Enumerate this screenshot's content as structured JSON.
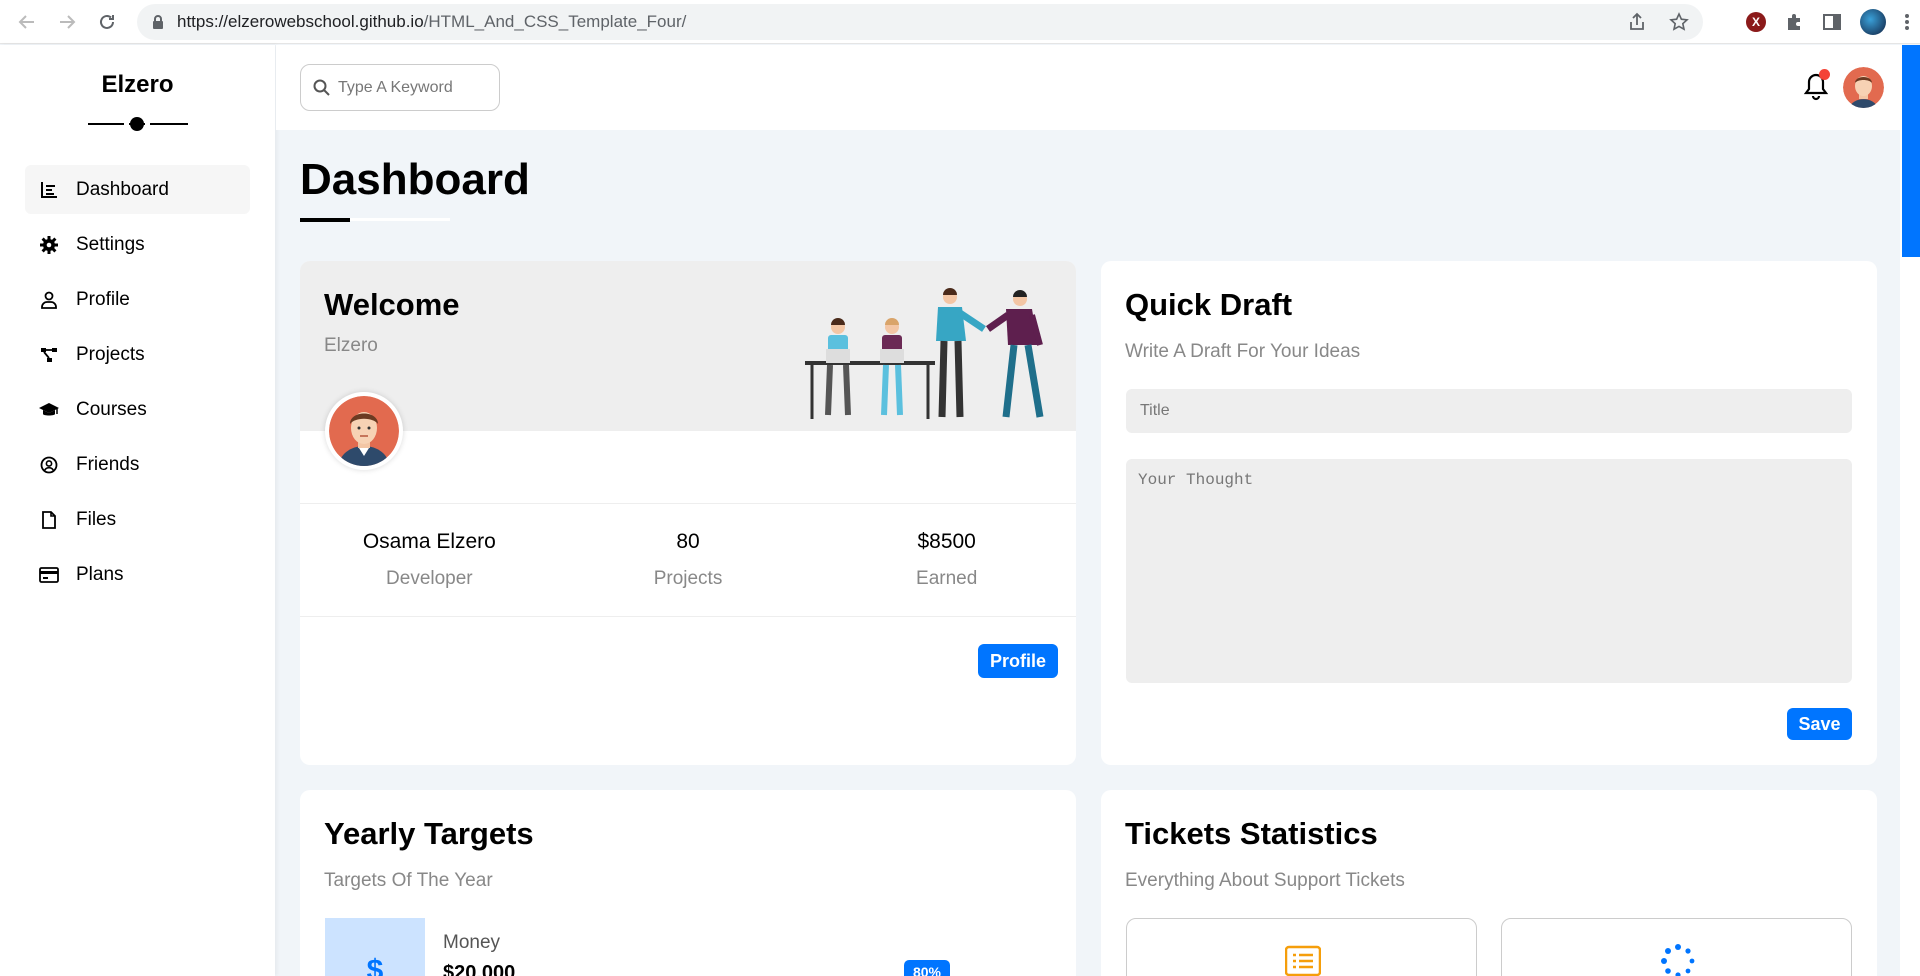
{
  "browser": {
    "url_host": "https://elzerowebschool.github.io",
    "url_path": "/HTML_And_CSS_Template_Four/"
  },
  "sidebar": {
    "brand": "Elzero",
    "items": [
      {
        "label": "Dashboard",
        "icon": "chart-icon",
        "active": true
      },
      {
        "label": "Settings",
        "icon": "gear-icon"
      },
      {
        "label": "Profile",
        "icon": "user-icon"
      },
      {
        "label": "Projects",
        "icon": "diagram-icon"
      },
      {
        "label": "Courses",
        "icon": "graduation-cap-icon"
      },
      {
        "label": "Friends",
        "icon": "user-circle-icon"
      },
      {
        "label": "Files",
        "icon": "file-icon"
      },
      {
        "label": "Plans",
        "icon": "credit-card-icon"
      }
    ]
  },
  "header": {
    "search_placeholder": "Type A Keyword"
  },
  "page": {
    "title": "Dashboard"
  },
  "welcome": {
    "title": "Welcome",
    "subtitle": "Elzero",
    "stats": [
      {
        "value": "Osama Elzero",
        "label": "Developer"
      },
      {
        "value": "80",
        "label": "Projects"
      },
      {
        "value": "$8500",
        "label": "Earned"
      }
    ],
    "button": "Profile"
  },
  "draft": {
    "title": "Quick Draft",
    "subtitle": "Write A Draft For Your Ideas",
    "title_placeholder": "Title",
    "text_placeholder": "Your Thought",
    "button": "Save"
  },
  "targets": {
    "title": "Yearly Targets",
    "subtitle": "Targets Of The Year",
    "item_icon": "$",
    "item_label": "Money",
    "item_value": "$20.000",
    "item_badge": "80%"
  },
  "tickets": {
    "title": "Tickets Statistics",
    "subtitle": "Everything About Support Tickets"
  },
  "colors": {
    "accent": "#0075ff",
    "notification": "#f44336"
  }
}
